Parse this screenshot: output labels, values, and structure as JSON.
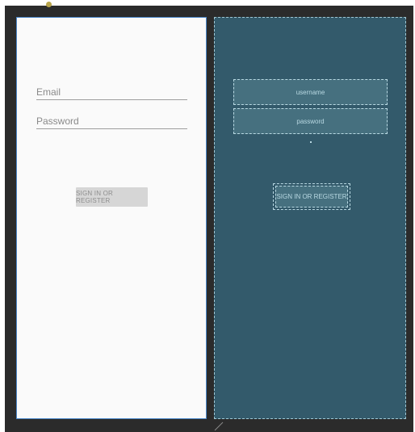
{
  "design": {
    "email_hint": "Email",
    "password_hint": "Password",
    "signin_label": "SIGN IN OR REGISTER"
  },
  "blueprint": {
    "username_label": "username",
    "password_label": "password",
    "signin_label": "SIGN IN OR REGISTER"
  },
  "colors": {
    "editor_background": "#2b2b2b",
    "design_surface": "#fafafa",
    "blueprint_surface": "#335a6b",
    "selection_border": "#4a86c8"
  }
}
